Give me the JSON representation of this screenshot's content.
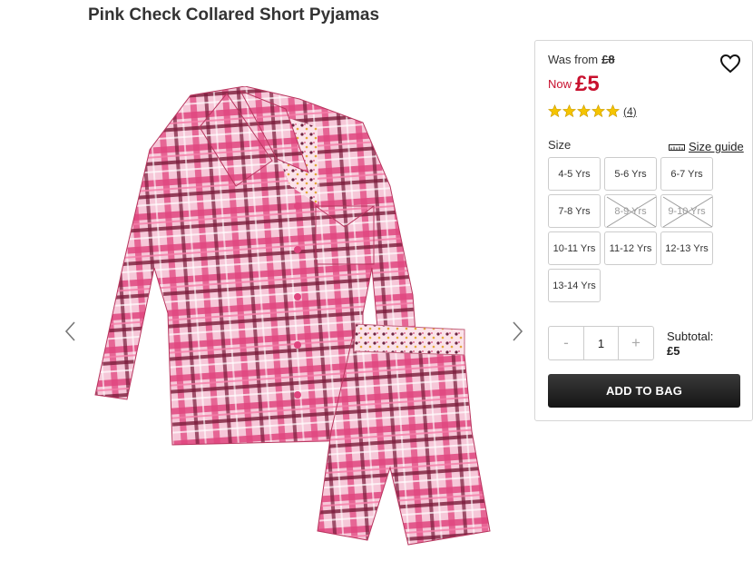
{
  "product": {
    "title": "Pink Check Collared Short Pyjamas"
  },
  "gallery": {
    "image_icon": "pink-check-pyjamas-image",
    "prev_icon": "chevron-left-icon",
    "next_icon": "chevron-right-icon"
  },
  "pricing": {
    "was_label": "Was from",
    "was_price": "£8",
    "now_label": "Now",
    "now_price": "£5"
  },
  "rating": {
    "stars": 5,
    "reviews": "(4)"
  },
  "size": {
    "label": "Size",
    "guide_label": "Size guide",
    "options": [
      {
        "label": "4-5 Yrs",
        "available": true
      },
      {
        "label": "5-6 Yrs",
        "available": true
      },
      {
        "label": "6-7 Yrs",
        "available": true
      },
      {
        "label": "7-8 Yrs",
        "available": true
      },
      {
        "label": "8-9 Yrs",
        "available": false
      },
      {
        "label": "9-10 Yrs",
        "available": false
      },
      {
        "label": "10-11 Yrs",
        "available": true
      },
      {
        "label": "11-12 Yrs",
        "available": true
      },
      {
        "label": "12-13 Yrs",
        "available": true
      },
      {
        "label": "13-14 Yrs",
        "available": true
      }
    ]
  },
  "quantity": {
    "minus": "-",
    "value": "1",
    "plus": "+"
  },
  "subtotal": {
    "label": "Subtotal:",
    "value": "£5"
  },
  "actions": {
    "add_to_bag": "ADD TO BAG"
  },
  "colors": {
    "sale_red": "#c8102e",
    "star_yellow": "#f5c400",
    "button_dark": "#1e1e1e"
  }
}
